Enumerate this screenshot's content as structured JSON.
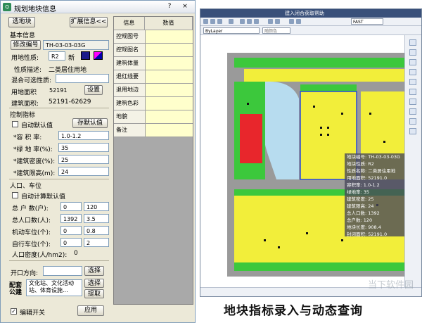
{
  "dialog": {
    "title": "规划地块信息",
    "help": "?",
    "close": "×",
    "select_block": "选地块",
    "expand_info": "扩展信息<<",
    "basic_info_heading": "基本信息",
    "modify_code": "修改编号",
    "block_code": "TH-03-03-03G",
    "land_nature_label": "用地性质:",
    "land_nature_value": "R2",
    "new_label": "新",
    "nature_desc_label": "性质描述:",
    "nature_desc_value": "二类居住用地",
    "mixed_label": "混合可选性质:",
    "land_area_label": "用地面积",
    "land_area_value": "52191",
    "set_button": "设置",
    "building_area_label": "建筑面积:",
    "building_area_value": "52191-62629",
    "control_heading": "控制指标",
    "auto_default": "自动默认值",
    "save_default": "存默认值",
    "far_label": "*容 积 率:",
    "far_value": "1.0-1.2",
    "green_label": "*绿 地 率(%):",
    "green_value": "35",
    "density_label": "*建筑密度(%):",
    "density_value": "25",
    "height_label": "*建筑限高(m):",
    "height_value": "24",
    "pop_heading": "人口、车位",
    "auto_calc": "自动计算默认值",
    "households_label": "总 户 数(户):",
    "households_min": "0",
    "households_max": "120",
    "population_label": "总人口数(人):",
    "population_min": "1392",
    "population_max": "3.5",
    "motor_label": "机动车位(个):",
    "motor_min": "0",
    "motor_max": "0.8",
    "bike_label": "自行车位(个):",
    "bike_min": "0",
    "bike_max": "2",
    "pop_density_label": "人口密度(人/hm2):",
    "pop_density_value": "0",
    "opening_label": "开口方向:",
    "select_btn": "选择",
    "facilities_label": "配套公建",
    "facilities_text": "文化站、文化活动站、体育设施...",
    "select_btn2": "选择",
    "extract_btn": "提取",
    "edit_switch": "编辑开关",
    "apply_btn": "应用"
  },
  "grid": {
    "col_info": "信息",
    "col_value": "数值",
    "rows": [
      "控规图号",
      "控规图名",
      "建筑体量",
      "退红线要",
      "退用地边",
      "建筑色彩",
      "地貌",
      "备注"
    ]
  },
  "cad": {
    "title": "建入闭合获取帮助",
    "layer": "ByLayer",
    "color": "随颜色",
    "font": "FAST",
    "tooltip": [
      "地块编号: TH-03-03-03G",
      "地块性质: R2",
      "性质名称: 二类居住用地",
      "用地面积: 52191.0",
      "容积率: 1.0-1.2",
      "绿地率: 35",
      "建筑密度: 25",
      "建筑限高: 24",
      "总人口数: 1392",
      "总户数: 120",
      "地块长度: 908.4",
      "封闭面积: 52191.0"
    ]
  },
  "caption": "地块指标录入与动态查询",
  "watermark": "当下软件园",
  "colors": {
    "residential": "#f2ee3a",
    "commercial": "#e8262c",
    "green": "#3cc83c",
    "road": "#9a9a9a",
    "water": "#b7dcef"
  }
}
